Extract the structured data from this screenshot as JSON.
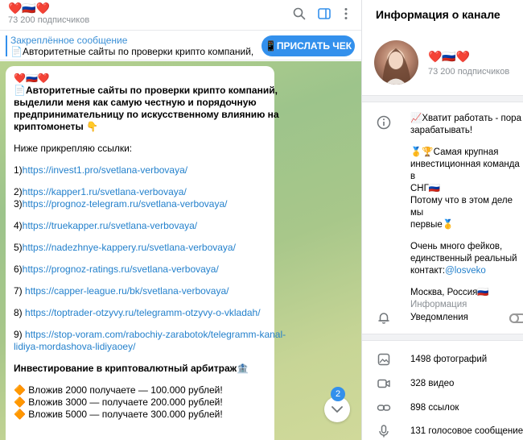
{
  "channel": {
    "title": "❤️🇷🇺❤️",
    "subscribers": "73 200 подписчиков"
  },
  "topbar_icons": [
    "search-icon",
    "sidebar-toggle-icon",
    "more-vertical-icon"
  ],
  "pinned": {
    "label": "Закреплённое сообщение",
    "text": "📄Авторитетные сайты по проверки крипто компаний, в...",
    "button": "📱ПРИСЛАТЬ ЧЕК📱"
  },
  "message": {
    "header_emoji": "❤️🇷🇺❤️",
    "intro": [
      "📄Авторитетные сайты по проверки крипто компаний,",
      "выделили меня как самую честную и порядочную",
      "предпринимательницу по искусственному влиянию на",
      "криптомонеты 👇"
    ],
    "links_intro": "Ниже прикрепляю ссылки:",
    "links": [
      {
        "num": "1)",
        "url": "https://invest1.pro/svetlana-verbovaya/"
      },
      {
        "num": "2)",
        "url": "https://kapper1.ru/svetlana-verbovaya/"
      },
      {
        "num": "3)",
        "url": "https://prognoz-telegram.ru/svetlana-verbovaya/"
      },
      {
        "num": "4)",
        "url": "https://truekapper.ru/svetlana-verbovaya/"
      },
      {
        "num": "5)",
        "url": "https://nadezhnye-kappery.ru/svetlana-verbovaya/"
      },
      {
        "num": "6)",
        "url": "https://prognoz-ratings.ru/svetlana-verbovaya/"
      },
      {
        "num": "7) ",
        "url": "https://capper-league.ru/bk/svetlana-verbovaya/"
      },
      {
        "num": "8) ",
        "url": "https://toptrader-otzyvy.ru/telegramm-otzyvy-o-vkladah/"
      },
      {
        "num": "9) ",
        "url": "https://stop-voram.com/rabochiy-zarabotok/telegramm-kanal-",
        "url2": "lidiya-mordashova-lidiyaoey/"
      }
    ],
    "invest_title": "Инвестирование в криптовалютный арбитраж🏦",
    "invest_lines": [
      "🔶 Вложив 2000 получаете — 100.000 рублей!",
      "🔶 Вложив 3000 — получаете 200.000 рублей!",
      "🔶 Вложив 5000 — получаете 300.000 рублей!"
    ],
    "unread_count": "2"
  },
  "info": {
    "header": "Информация о канале",
    "name": "❤️🇷🇺❤️",
    "subscribers": "73 200 подписчиков",
    "about": {
      "p1": [
        "📈Хватит работать - пора",
        "зарабатывать!"
      ],
      "p2": [
        "🥇🏆Самая крупная",
        "инвестиционная команда в",
        "СНГ🇷🇺",
        "Потому что в этом деле мы",
        "первые🥇"
      ],
      "p3_a": [
        "Очень много фейков,",
        "единственный реальный"
      ],
      "p3_contact_prefix": "контакт:",
      "p3_contact_link": "@losveko",
      "location": "Москва, Россия🇷🇺",
      "caption": "Информация"
    },
    "notifications_label": "Уведомления",
    "media": [
      {
        "icon": "photo-icon",
        "label": "1498 фотографий"
      },
      {
        "icon": "video-icon",
        "label": "328 видео"
      },
      {
        "icon": "link-icon",
        "label": "898 ссылок"
      },
      {
        "icon": "microphone-icon",
        "label": "131 голосовое сообщение"
      }
    ]
  }
}
